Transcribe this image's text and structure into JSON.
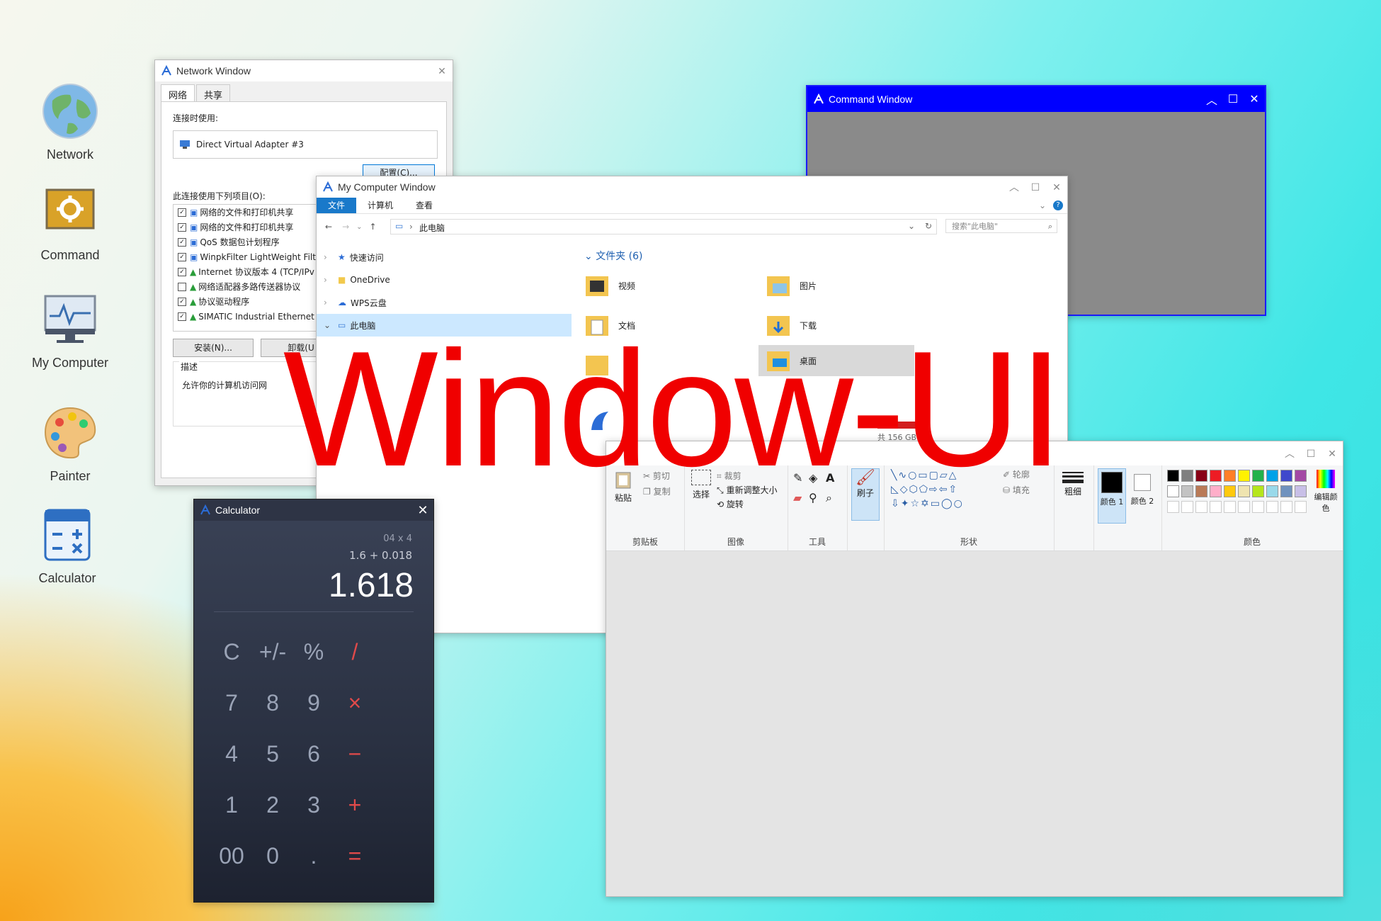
{
  "desktop": {
    "icons": [
      {
        "label": "Network"
      },
      {
        "label": "Command"
      },
      {
        "label": "My Computer"
      },
      {
        "label": "Painter"
      },
      {
        "label": "Calculator"
      }
    ]
  },
  "network_window": {
    "title": "Network Window",
    "tabs": [
      "网络",
      "共享"
    ],
    "connect_using_label": "连接时使用:",
    "adapter": "Direct Virtual Adapter #3",
    "configure_button": "配置(C)...",
    "items_label": "此连接使用下列项目(O):",
    "items": [
      {
        "checked": true,
        "label": "网络的文件和打印机共享"
      },
      {
        "checked": true,
        "label": "网络的文件和打印机共享"
      },
      {
        "checked": true,
        "label": "QoS 数据包计划程序"
      },
      {
        "checked": true,
        "label": "WinpkFilter LightWeight Filte"
      },
      {
        "checked": true,
        "label": "Internet 协议版本 4 (TCP/IPv"
      },
      {
        "checked": false,
        "label": "网络适配器多路传送器协议"
      },
      {
        "checked": true,
        "label": "协议驱动程序"
      },
      {
        "checked": true,
        "label": "SIMATIC Industrial Ethernet"
      }
    ],
    "install_button": "安装(N)...",
    "uninstall_button": "卸载(U",
    "description_label": "描述",
    "description_text": "允许你的计算机访问网"
  },
  "command_window": {
    "title": "Command Window"
  },
  "my_computer_window": {
    "title": "My Computer Window",
    "ribbon_tabs": [
      "文件",
      "计算机",
      "查看"
    ],
    "address": "此电脑",
    "search_placeholder": "搜索\"此电脑\"",
    "nav_items": [
      {
        "label": "快速访问"
      },
      {
        "label": "OneDrive"
      },
      {
        "label": "WPS云盘"
      },
      {
        "label": "此电脑"
      }
    ],
    "folders_header": "文件夹 (6)",
    "folders": [
      "视频",
      "图片",
      "文档",
      "下载",
      "",
      "桌面"
    ],
    "drive_free": "共 156 GB"
  },
  "painter_window": {
    "clipboard": {
      "paste": "粘贴",
      "cut": "剪切",
      "copy": "复制",
      "group": "剪贴板"
    },
    "image": {
      "select": "选择",
      "crop": "裁剪",
      "resize": "重新调整大小",
      "rotate": "旋转",
      "group": "图像"
    },
    "tools_group": "工具",
    "brush": "刷子",
    "shapes": {
      "outline": "轮廓",
      "fill": "填充",
      "group": "形状"
    },
    "size": "粗细",
    "color1": "颜色 1",
    "color2": "颜色 2",
    "edit_colors": "编辑颜色",
    "colors_group": "颜色",
    "palette": [
      "#000000",
      "#7f7f7f",
      "#880015",
      "#ed1c24",
      "#ff7f27",
      "#fff200",
      "#22b14c",
      "#00a2e8",
      "#3f48cc",
      "#a349a4",
      "#ffffff",
      "#c3c3c3",
      "#b97a57",
      "#ffaec9",
      "#ffc90e",
      "#efe4b0",
      "#b5e61d",
      "#99d9ea",
      "#7092be",
      "#c8bfe7"
    ]
  },
  "calculator_window": {
    "title": "Calculator",
    "expr_prev": "04 x 4",
    "expr": "1.6 + 0.018",
    "result": "1.618",
    "keys": [
      [
        "C",
        "+/-",
        "%",
        "/"
      ],
      [
        "7",
        "8",
        "9",
        "×"
      ],
      [
        "4",
        "5",
        "6",
        "−"
      ],
      [
        "1",
        "2",
        "3",
        "+"
      ],
      [
        "00",
        "0",
        ".",
        "="
      ]
    ]
  },
  "banner": "Window-UI"
}
